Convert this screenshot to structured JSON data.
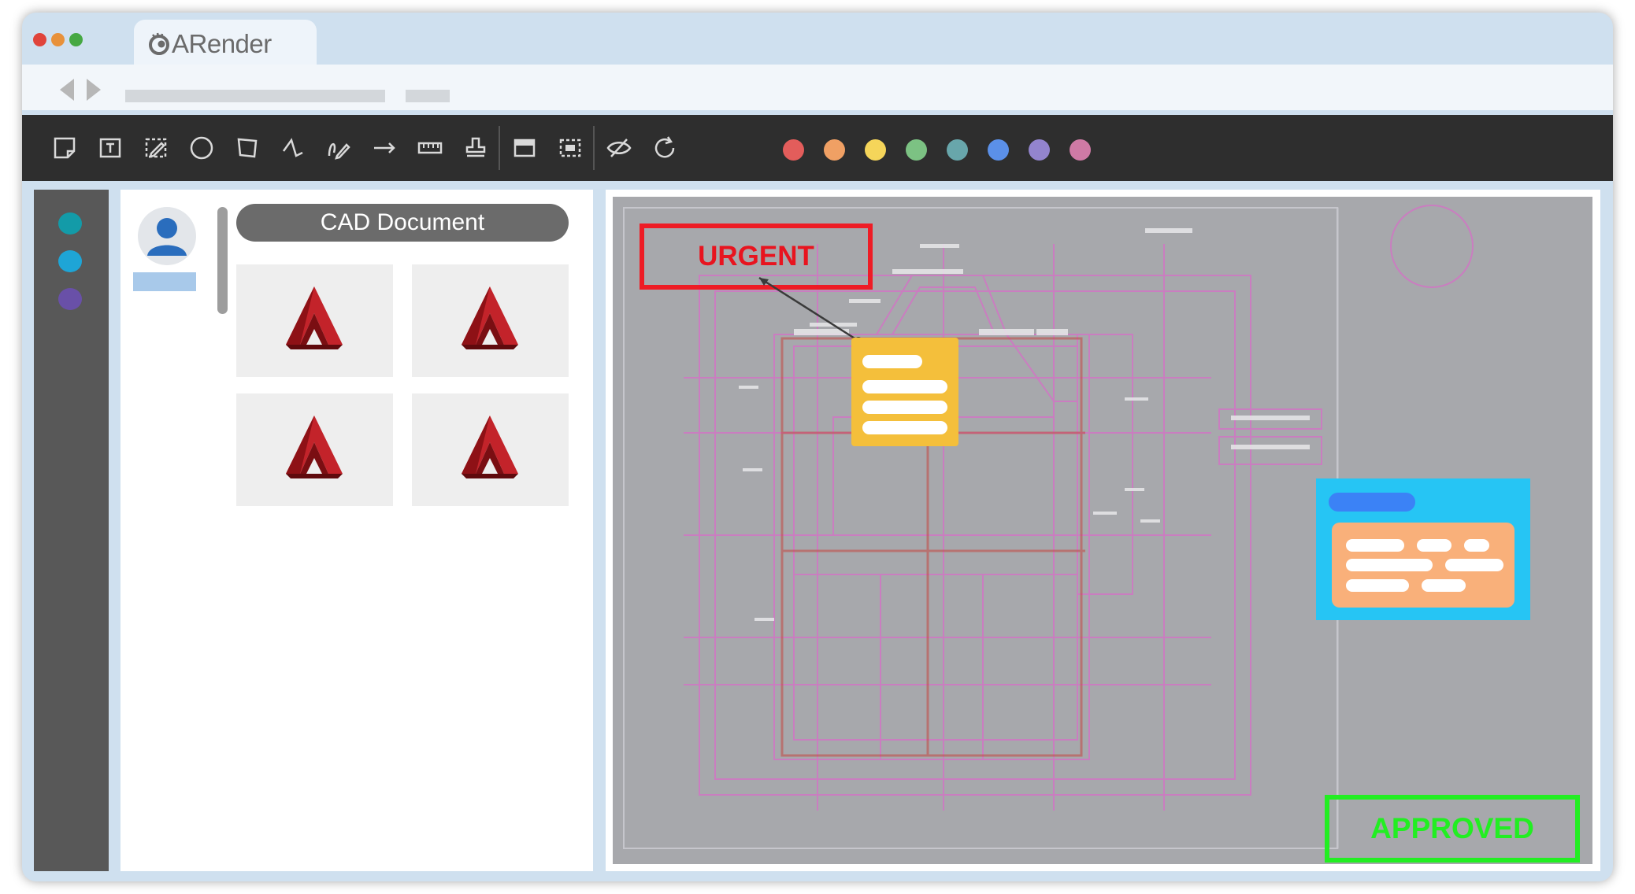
{
  "app": {
    "title": "ARender"
  },
  "toolbar": {
    "tools": [
      {
        "name": "sticky-note-icon"
      },
      {
        "name": "text-box-icon"
      },
      {
        "name": "edit-icon"
      },
      {
        "name": "circle-icon"
      },
      {
        "name": "polygon-icon"
      },
      {
        "name": "polyline-icon"
      },
      {
        "name": "freehand-icon"
      },
      {
        "name": "arrow-icon"
      },
      {
        "name": "ruler-icon"
      },
      {
        "name": "stamp-icon"
      },
      {
        "name": "redact-icon"
      },
      {
        "name": "area-select-icon"
      },
      {
        "name": "hide-annotations-icon"
      },
      {
        "name": "rotate-icon"
      }
    ],
    "colors": [
      "#e35d5b",
      "#f0a064",
      "#f5d55a",
      "#7cc283",
      "#68a6ab",
      "#5b90e8",
      "#9384ce",
      "#cf7aa5"
    ]
  },
  "sidebar": {
    "dots": [
      "#139ba8",
      "#1ea5d6",
      "#6950a8"
    ]
  },
  "panel": {
    "document_label": "CAD Document",
    "thumbnails": [
      {
        "name": "cad-thumbnail-1"
      },
      {
        "name": "cad-thumbnail-2"
      },
      {
        "name": "cad-thumbnail-3"
      },
      {
        "name": "cad-thumbnail-4"
      }
    ]
  },
  "viewer": {
    "stamp_urgent": "URGENT",
    "stamp_approved": "APPROVED"
  }
}
